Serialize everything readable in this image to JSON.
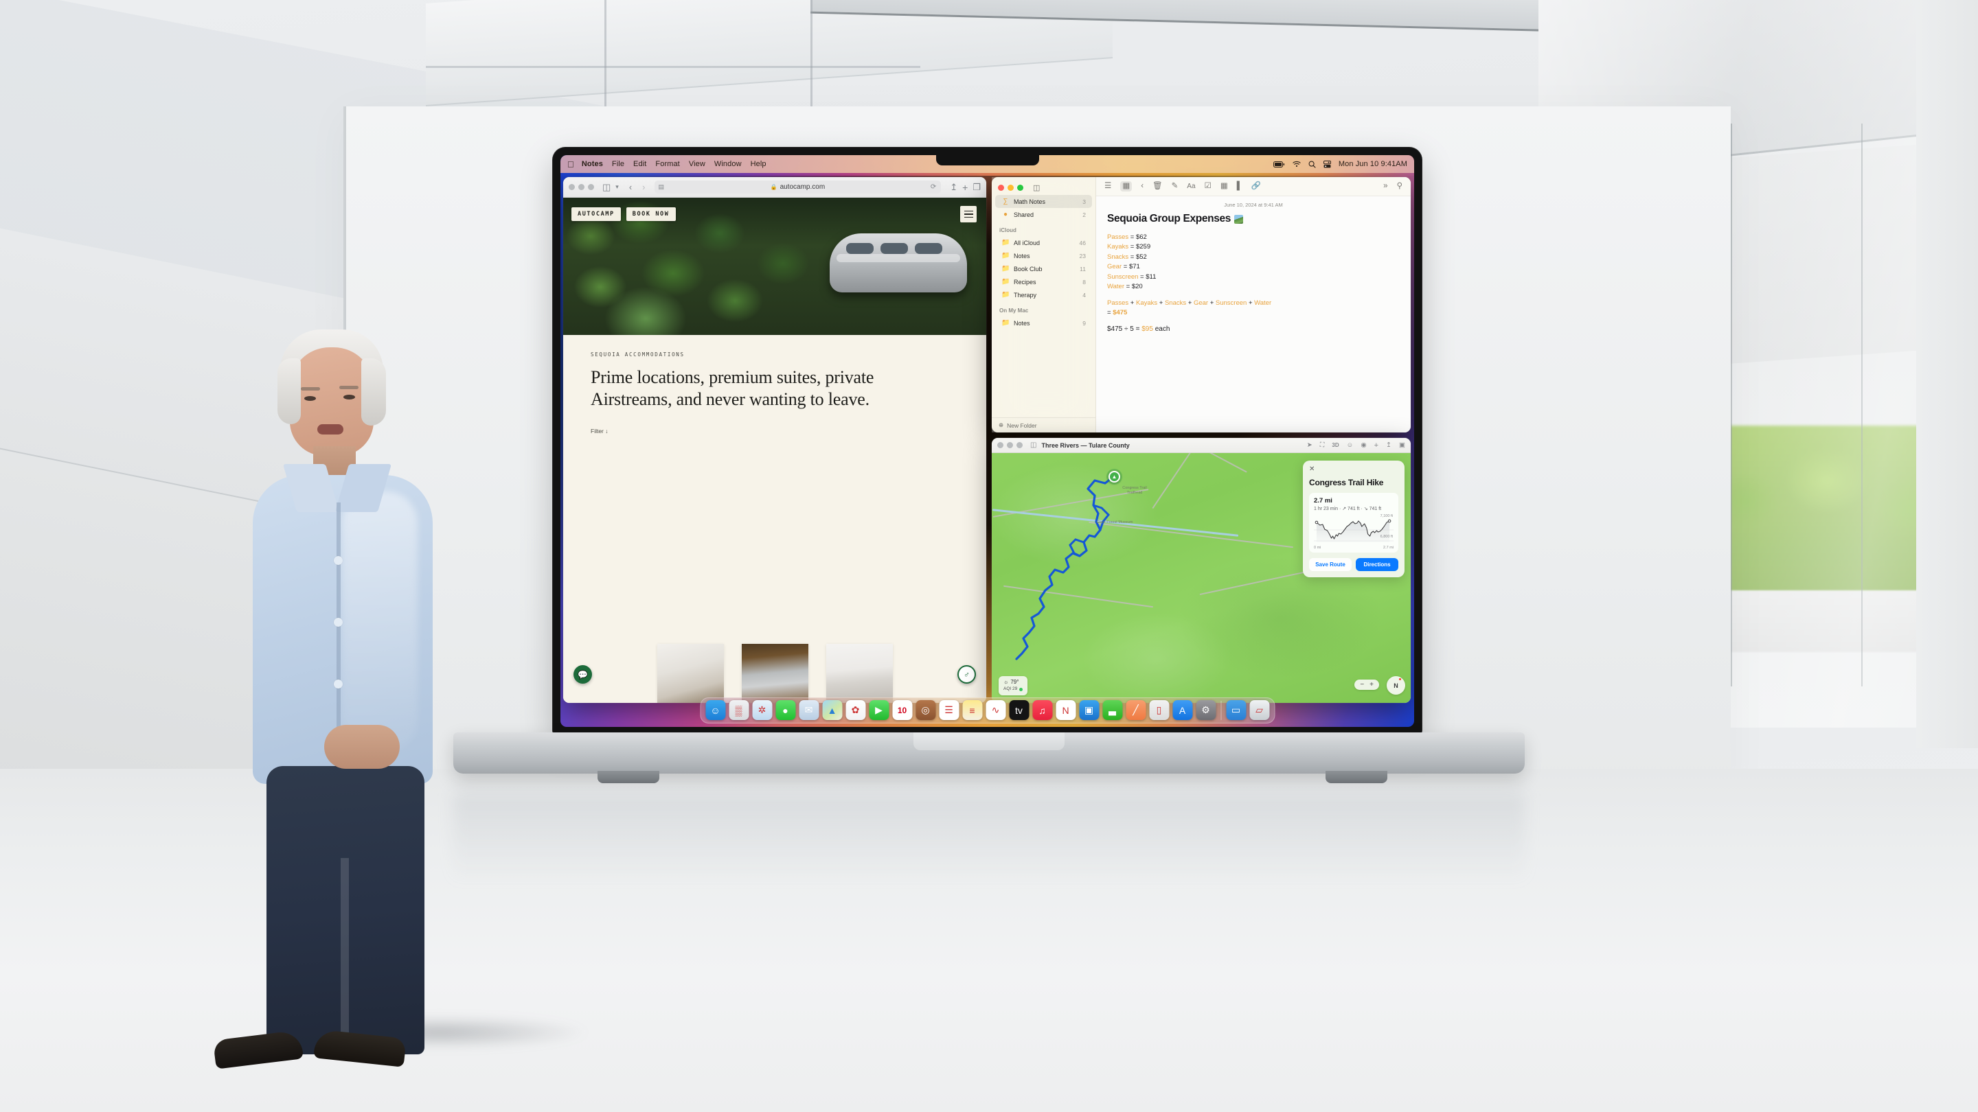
{
  "scene": {
    "venue": "Apple Park glass interior stage",
    "presenter_shirt_color": "#c2d4e8"
  },
  "menubar": {
    "apple_logo": "apple-logo",
    "items": [
      "Notes",
      "File",
      "Edit",
      "Format",
      "View",
      "Window",
      "Help"
    ],
    "status_icons": [
      "battery-icon",
      "wifi-icon",
      "search-icon",
      "control-center-icon"
    ],
    "clock": "Mon Jun 10  9:41AM"
  },
  "safari": {
    "traffic_lights": [
      "close",
      "minimize",
      "zoom"
    ],
    "sidebar_icon": "sidebar-icon",
    "back_icon": "chevron-left-icon",
    "forward_icon": "chevron-right-icon",
    "url": "autocamp.com",
    "lock_icon": "lock-icon",
    "reader_icon": "reader-icon",
    "reload_icon": "reload-icon",
    "share_icon": "share-icon",
    "new_tab_icon": "plus-icon",
    "tab_overview_icon": "tab-overview-icon",
    "site": {
      "brand": "AUTOCAMP",
      "cta": "BOOK NOW",
      "menu_icon": "hamburger-icon",
      "eyebrow": "SEQUOIA ACCOMMODATIONS",
      "headline": "Prime locations, premium suites, private Airstreams, and never wanting to leave.",
      "filter_label": "Filter ↓",
      "thumbnails": [
        "airstream-interior-kitchen",
        "airstream-exterior-forest",
        "airstream-bedroom"
      ],
      "chat_fab": "chat-icon",
      "accessibility_fab": "accessibility-icon"
    }
  },
  "notes": {
    "traffic_lights": [
      "close",
      "minimize",
      "zoom"
    ],
    "sidebar_toggle_icon": "sidebar-icon",
    "toolbar_icons": [
      "list-view-icon",
      "gallery-view-icon",
      "back-icon",
      "delete-icon",
      "compose-icon",
      "format-icon",
      "checklist-icon",
      "table-icon",
      "audio-icon",
      "link-icon",
      "more-icon",
      "search-icon"
    ],
    "sidebar": {
      "pinned": [
        {
          "icon": "math-notes-icon",
          "label": "Math Notes",
          "count": "3",
          "active": true
        },
        {
          "icon": "shared-icon",
          "label": "Shared",
          "count": "2",
          "active": false
        }
      ],
      "sections": [
        {
          "title": "iCloud",
          "folders": [
            {
              "icon": "folder-icon",
              "label": "All iCloud",
              "count": "46"
            },
            {
              "icon": "folder-icon",
              "label": "Notes",
              "count": "23"
            },
            {
              "icon": "folder-icon",
              "label": "Book Club",
              "count": "11"
            },
            {
              "icon": "folder-icon",
              "label": "Recipes",
              "count": "8"
            },
            {
              "icon": "folder-icon",
              "label": "Therapy",
              "count": "4"
            }
          ]
        },
        {
          "title": "On My Mac",
          "folders": [
            {
              "icon": "folder-icon",
              "label": "Notes",
              "count": "9"
            }
          ]
        }
      ],
      "new_folder_label": "New Folder",
      "new_folder_icon": "plus-circle-icon"
    },
    "note": {
      "date": "June 10, 2024 at 9:41 AM",
      "title": "Sequoia Group Expenses",
      "title_emoji": "mountain-photo-emoji",
      "expenses": [
        {
          "name": "Passes",
          "value": "$62"
        },
        {
          "name": "Kayaks",
          "value": "$259"
        },
        {
          "name": "Snacks",
          "value": "$52"
        },
        {
          "name": "Gear",
          "value": "$71"
        },
        {
          "name": "Sunscreen",
          "value": "$11"
        },
        {
          "name": "Water",
          "value": "$20"
        }
      ],
      "sum_terms": [
        "Passes",
        "Kayaks",
        "Snacks",
        "Gear",
        "Sunscreen",
        "Water"
      ],
      "sum_total": "$475",
      "division_expr": "$475 ÷ 5 = ",
      "division_result": "$95",
      "division_suffix": " each",
      "math_accent_color": "#e8a33d"
    }
  },
  "maps": {
    "traffic_lights": [
      "close",
      "minimize",
      "zoom"
    ],
    "sidebar_icon": "sidebar-icon",
    "title": "Three Rivers — Tulare County",
    "toolbar_icons": [
      "locate-icon",
      "maps-look-around-icon",
      "3d-icon",
      "binoculars-icon",
      "compass-icon",
      "plus-icon",
      "share-icon",
      "account-icon"
    ],
    "map_labels": [
      "Congress Trail Trailhead",
      "Giant Forest Museum"
    ],
    "weather": {
      "icon": "sun-icon",
      "temp": "79°",
      "aqi": "AQI 29"
    },
    "zoom_controls": {
      "minus": "−",
      "plus": "+"
    },
    "compass": "N",
    "route_card": {
      "close_icon": "close-icon",
      "title": "Congress Trail Hike",
      "distance": "2.7 mi",
      "details": "1 hr 23 min · ↗ 741 ft · ↘ 741 ft",
      "elev_high": "7,100 ft",
      "elev_low": "6,800 ft",
      "axis_start": "0 mi",
      "axis_end": "2.7 mi",
      "save_button": "Save Route",
      "directions_button": "Directions",
      "accent_color": "#0a7aff"
    }
  },
  "dock": {
    "apps": [
      {
        "name": "finder",
        "glyph": "☺",
        "bg": "linear-gradient(180deg,#3aa8ee,#1c7ed6)",
        "running": true
      },
      {
        "name": "launchpad",
        "glyph": "▒",
        "bg": "linear-gradient(180deg,#f0f1f3,#d8dade)",
        "running": false
      },
      {
        "name": "safari",
        "glyph": "✲",
        "bg": "linear-gradient(180deg,#e9f3fb,#bfd9ef)",
        "running": true
      },
      {
        "name": "messages",
        "glyph": "●",
        "bg": "linear-gradient(180deg,#5ee06a,#22c032)",
        "running": false
      },
      {
        "name": "mail",
        "glyph": "✉",
        "bg": "linear-gradient(180deg,#dfeaf5,#b9cee3)",
        "running": false
      },
      {
        "name": "maps",
        "glyph": "▲",
        "bg": "linear-gradient(140deg,#9fd8f5,#cfe8a8 55%,#eef0e0)",
        "running": true
      },
      {
        "name": "photos",
        "glyph": "✿",
        "bg": "linear-gradient(180deg,#ffffff,#f2f2f4)",
        "running": false
      },
      {
        "name": "facetime",
        "glyph": "▶",
        "bg": "linear-gradient(180deg,#5ee06a,#22b92f)",
        "running": false
      },
      {
        "name": "calendar",
        "glyph": "10",
        "bg": "#ffffff",
        "running": false
      },
      {
        "name": "contacts",
        "glyph": "◎",
        "bg": "linear-gradient(180deg,#b4764a,#8a5330)",
        "running": false
      },
      {
        "name": "reminders",
        "glyph": "☰",
        "bg": "#ffffff",
        "running": false
      },
      {
        "name": "notes",
        "glyph": "≡",
        "bg": "linear-gradient(180deg,#fde98d,#f5f0e2)",
        "running": true
      },
      {
        "name": "freeform",
        "glyph": "∿",
        "bg": "#ffffff",
        "running": false
      },
      {
        "name": "appletv",
        "glyph": "tv",
        "bg": "#141414",
        "running": false
      },
      {
        "name": "music",
        "glyph": "♫",
        "bg": "linear-gradient(180deg,#fb4a5c,#e8213c)",
        "running": false
      },
      {
        "name": "news",
        "glyph": "N",
        "bg": "#ffffff",
        "running": false
      },
      {
        "name": "keynote",
        "glyph": "▣",
        "bg": "linear-gradient(180deg,#3aa4ef,#1a72cc)",
        "running": false
      },
      {
        "name": "numbers",
        "glyph": "▃",
        "bg": "linear-gradient(180deg,#5fd557,#29b021)",
        "running": false
      },
      {
        "name": "pages",
        "glyph": "╱",
        "bg": "linear-gradient(180deg,#f79e6e,#ef7a42)",
        "running": false
      },
      {
        "name": "iphone-mirroring",
        "glyph": "▯",
        "bg": "linear-gradient(180deg,#f2f2f2,#dcdcdc)",
        "running": false
      },
      {
        "name": "app-store",
        "glyph": "A",
        "bg": "linear-gradient(180deg,#3f9df5,#1273e0)",
        "running": false
      },
      {
        "name": "system-settings",
        "glyph": "⚙",
        "bg": "linear-gradient(180deg,#9a9a9e,#6d6d72)",
        "running": false
      }
    ],
    "folder": {
      "name": "downloads-folder",
      "glyph": "▭",
      "bg": "linear-gradient(180deg,#4aa3e8,#2a7fd4)"
    },
    "trash": {
      "name": "trash",
      "glyph": "▱",
      "bg": "linear-gradient(180deg,#f0f2f4,#c9ced2)"
    }
  }
}
